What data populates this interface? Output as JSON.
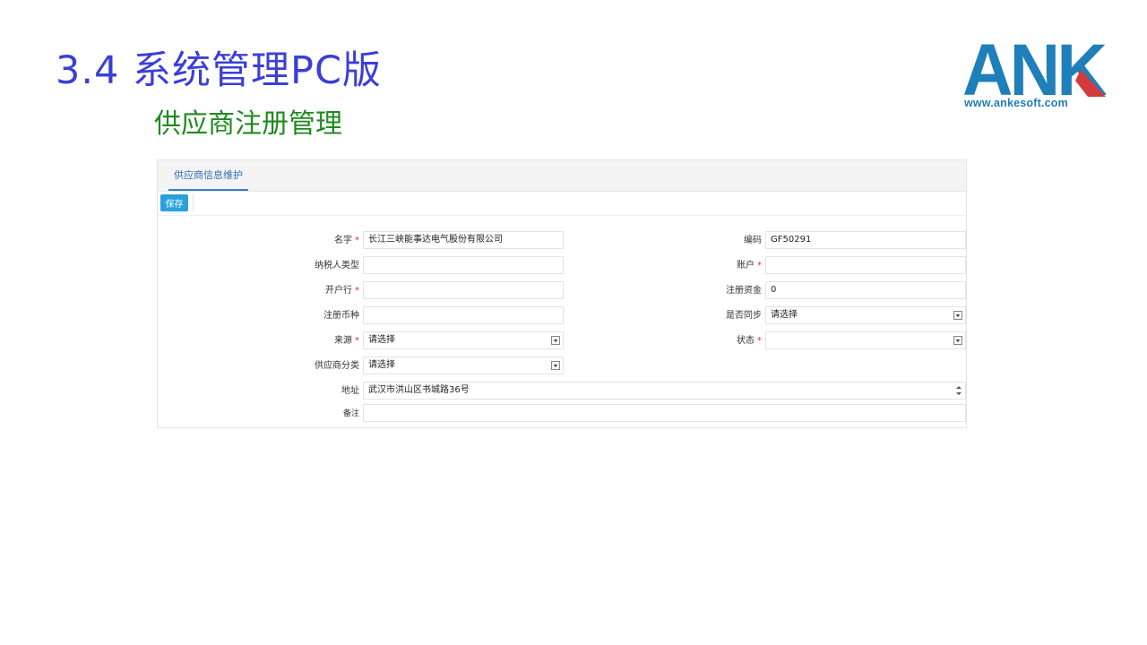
{
  "slide": {
    "title": "3.4 系统管理PC版",
    "subtitle": "供应商注册管理"
  },
  "logo": {
    "mark": "ANK",
    "url": "www.ankesoft.com"
  },
  "tab": {
    "label": "供应商信息维护"
  },
  "toolbar": {
    "save_label": "保存"
  },
  "required_mark": "*",
  "form": {
    "name": {
      "label": "名字",
      "value": "长江三峡能事达电气股份有限公司"
    },
    "code": {
      "label": "编码",
      "value": "GF50291"
    },
    "taxpayer_type": {
      "label": "纳税人类型",
      "value": ""
    },
    "account": {
      "label": "账户",
      "value": ""
    },
    "bank": {
      "label": "开户行",
      "value": ""
    },
    "registered_capital": {
      "label": "注册资金",
      "value": "0"
    },
    "currency": {
      "label": "注册币种",
      "value": ""
    },
    "sync": {
      "label": "是否同步",
      "value": "请选择"
    },
    "source": {
      "label": "来源",
      "value": "请选择"
    },
    "status": {
      "label": "状态",
      "value": ""
    },
    "category": {
      "label": "供应商分类",
      "value": "请选择"
    },
    "address": {
      "label": "地址",
      "value": "武汉市洪山区书城路36号"
    },
    "remark": {
      "label": "备注",
      "value": ""
    }
  },
  "colors": {
    "title": "#3b3fd6",
    "subtitle": "#1f8a1f",
    "logo_blue": "#1f7fb8",
    "logo_red": "#d23b3b",
    "save_button": "#2aa0dc",
    "required": "#d9302c"
  }
}
